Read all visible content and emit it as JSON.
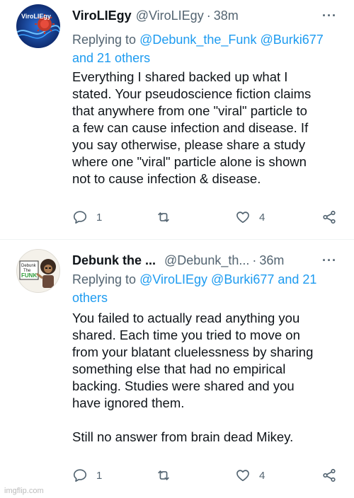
{
  "tweets": [
    {
      "name": "ViroLIEgy",
      "handle": "@ViroLIEgy",
      "separator": "·",
      "time": "38m",
      "more": "···",
      "replying_prefix": "Replying to ",
      "replying_mentions": "@Debunk_the_Funk @Burki677",
      "replying_line2": "and 21 others",
      "body": "Everything I shared backed up what I\nstated. Your pseudoscience fiction claims\nthat anywhere from one \"viral\" particle to\na few can cause infection and disease. If\nyou say otherwise, please share a study\nwhere one \"viral\" particle alone is shown\nnot to cause infection & disease.",
      "replies": "1",
      "likes": "4",
      "avatar_text": "ViroLIEgy"
    },
    {
      "name": "Debunk the ...",
      "handle": "@Debunk_th...",
      "separator": "·",
      "time": "36m",
      "more": "···",
      "replying_prefix": "Replying to ",
      "replying_mentions": "@ViroLIEgy @Burki677 and 21",
      "replying_line2": "others",
      "body": "You failed to actually read anything you\nshared. Each time you tried to move on\nfrom your blatant cluelessness by sharing\nsomething else that had no empirical\nbacking. Studies were shared and you\nhave ignored them.\n\nStill no answer from brain dead Mikey.",
      "replies": "1",
      "likes": "4",
      "avatar_text": "Debunk The Funk"
    }
  ],
  "icons": {
    "reply": "reply-icon",
    "retweet": "retweet-icon",
    "like": "like-icon",
    "share": "share-icon"
  },
  "colors": {
    "mention": "#1d9bf0",
    "secondary": "#536471",
    "text": "#0f1419"
  },
  "watermark": "imgflip.com"
}
